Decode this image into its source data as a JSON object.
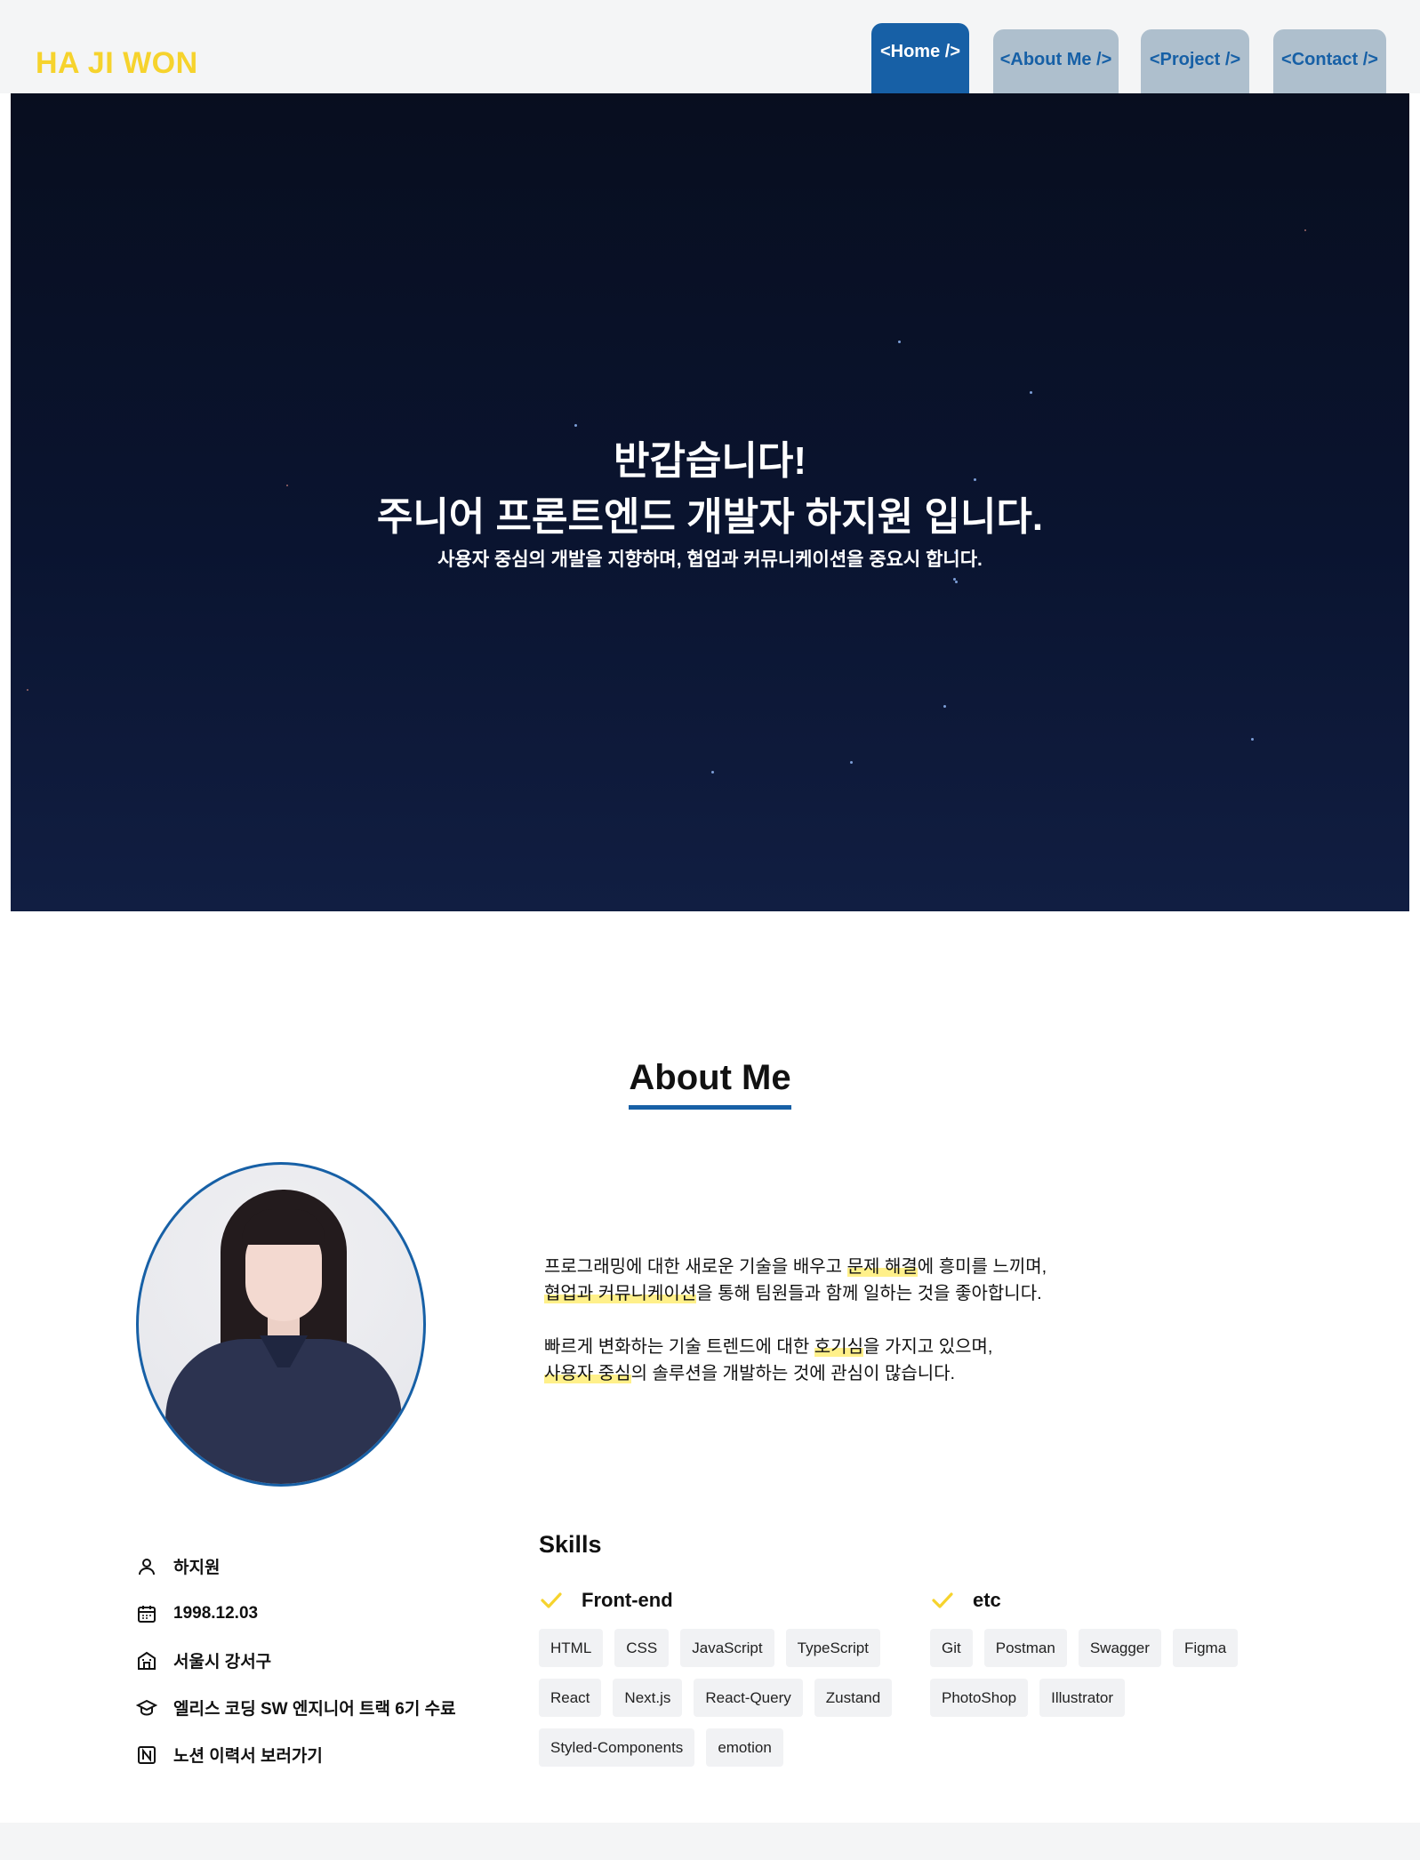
{
  "header": {
    "logo": "HA JI WON",
    "tabs": [
      {
        "label": "<Home />",
        "active": true
      },
      {
        "label": "<About Me />",
        "active": false
      },
      {
        "label": "<Project />",
        "active": false
      },
      {
        "label": "<Contact />",
        "active": false
      }
    ]
  },
  "hero": {
    "line1": "반갑습니다!",
    "line2": "주니어 프론트엔드 개발자 하지원 입니다.",
    "line3": "사용자 중심의 개발을 지향하며, 협업과 커뮤니케이션을 중요시 합니다."
  },
  "about": {
    "title": "About Me",
    "bio": {
      "p1_a": "프로그래밍에 대한 새로운 기술을 배우고 ",
      "p1_hl1": "문제 해결",
      "p1_b": "에 흥미를 느끼며,",
      "p1_hl2": "협업과 커뮤니케이션",
      "p1_c": "을 통해 팀원들과 함께 일하는 것을 좋아합니다.",
      "p2_a": "빠르게 변화하는 기술 트렌드에 대한 ",
      "p2_hl1": "호기심",
      "p2_b": "을 가지고 있으며,",
      "p2_hl2": "사용자 중심",
      "p2_c": "의 솔루션을 개발하는 것에 관심이 많습니다."
    },
    "info": {
      "name": "하지원",
      "birth": "1998.12.03",
      "location": "서울시 강서구",
      "education": "엘리스 코딩 SW 엔지니어 트랙 6기 수료",
      "resume_link": "노션 이력서 보러가기"
    },
    "skills": {
      "title": "Skills",
      "frontend": {
        "label": "Front-end",
        "items": [
          "HTML",
          "CSS",
          "JavaScript",
          "TypeScript",
          "React",
          "Next.js",
          "React-Query",
          "Zustand",
          "Styled-Components",
          "emotion"
        ]
      },
      "etc": {
        "label": "etc",
        "items": [
          "Git",
          "Postman",
          "Swagger",
          "Figma",
          "PhotoShop",
          "Illustrator"
        ]
      }
    }
  },
  "colors": {
    "brand_yellow": "#f6d32d",
    "brand_blue": "#1760a6",
    "tab_idle": "#aebfcd",
    "highlight": "#fff08a"
  },
  "icons": [
    "user-icon",
    "calendar-icon",
    "building-icon",
    "graduation-cap-icon",
    "notion-icon",
    "check-icon"
  ]
}
